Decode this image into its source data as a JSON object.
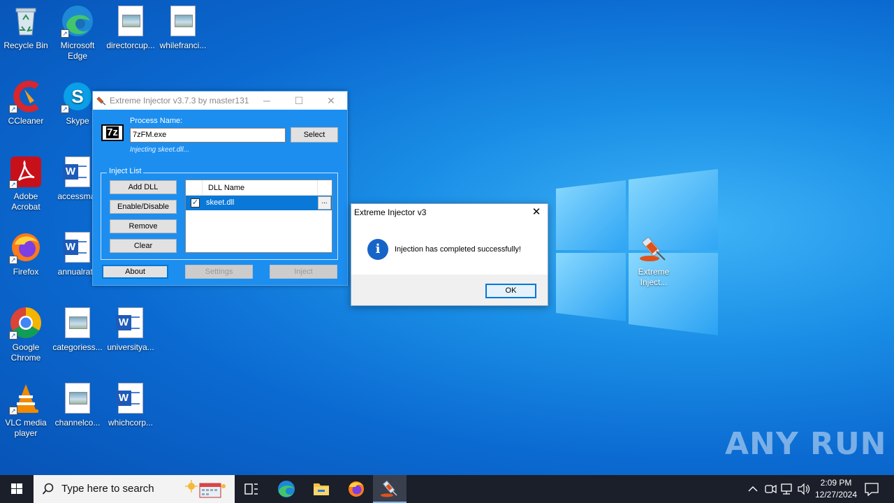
{
  "desktop": {
    "icons": [
      {
        "label": "Recycle Bin"
      },
      {
        "label": "Microsoft Edge"
      },
      {
        "label": "directorcup..."
      },
      {
        "label": "whilefranci..."
      },
      {
        "label": "CCleaner"
      },
      {
        "label": "Skype"
      },
      {
        "label": "Adobe Acrobat"
      },
      {
        "label": "accessmat"
      },
      {
        "label": "Firefox"
      },
      {
        "label": "annualrate"
      },
      {
        "label": "Google Chrome"
      },
      {
        "label": "categoriess..."
      },
      {
        "label": "universitya..."
      },
      {
        "label": "VLC media player"
      },
      {
        "label": "channelco..."
      },
      {
        "label": "whichcorp..."
      },
      {
        "label": "Extreme Inject..."
      }
    ]
  },
  "injector": {
    "title": "Extreme Injector v3.7.3 by master131",
    "process_label": "Process Name:",
    "process_value": "7zFM.exe",
    "select_button": "Select",
    "status": "Injecting skeet.dll...",
    "group_title": "Inject List",
    "buttons": {
      "add": "Add DLL",
      "enable": "Enable/Disable",
      "remove": "Remove",
      "clear": "Clear",
      "about": "About",
      "settings": "Settings",
      "inject": "Inject"
    },
    "list_header": "DLL Name",
    "rows": [
      {
        "name": "skeet.dll",
        "checked": true,
        "more": "..."
      }
    ],
    "seven_zip": "7z"
  },
  "message_box": {
    "title": "Extreme Injector v3",
    "text": "Injection has completed successfully!",
    "ok": "OK",
    "close": "✕"
  },
  "taskbar": {
    "search_placeholder": "Type here to search",
    "time": "2:09 PM",
    "date": "12/27/2024"
  },
  "watermark": "ANY RUN",
  "colors": {
    "accent": "#0078d7",
    "injector_bg": "#1c8ef0",
    "selection": "#0a78d7"
  }
}
